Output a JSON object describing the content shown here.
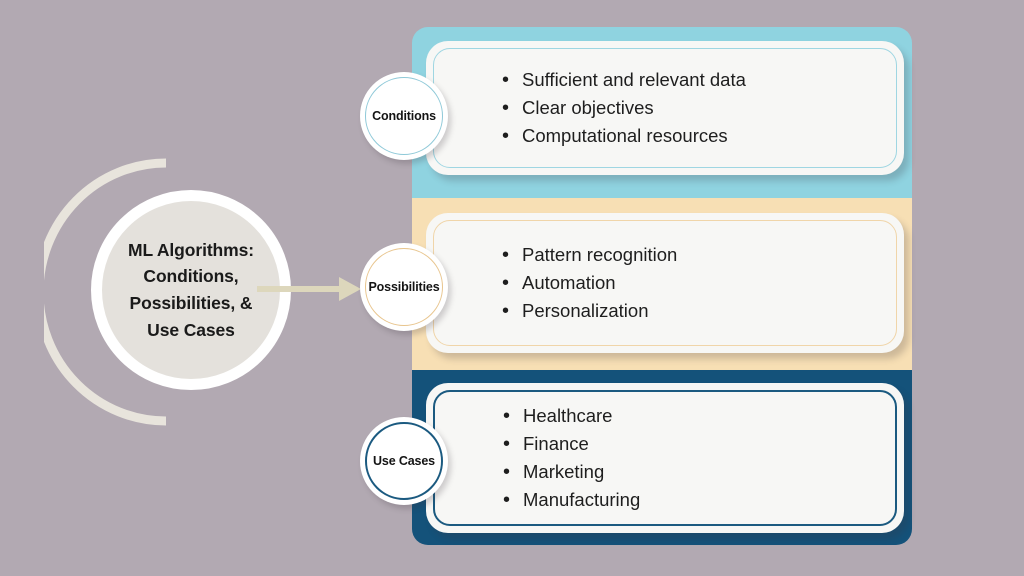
{
  "background_color": "#b2a9b2",
  "hub": {
    "title": "ML Algorithms: Conditions, Possibilities, & Use Cases",
    "title_lines": [
      "ML Algorithms:",
      "Conditions,",
      "Possibilities, &",
      "Use Cases"
    ],
    "fill_color": "#e4e1dc",
    "ring_color": "#ffffff",
    "arc_color": "#e8e4dc",
    "text_color": "#1a1a1a"
  },
  "arrow": {
    "name": "flow-arrow",
    "color": "#ddd7bc",
    "direction": "right"
  },
  "sections": [
    {
      "id": "conditions",
      "label": "Conditions",
      "band_color": "#8fd3e0",
      "border_color": "#9fd6e2",
      "card_color": "#f7f7f5",
      "items": [
        "Sufficient and relevant data",
        "Clear objectives",
        "Computational resources"
      ]
    },
    {
      "id": "possibilities",
      "label": "Possibilities",
      "band_color": "#f7dfb4",
      "border_color": "#f0d5a9",
      "card_color": "#f7f7f5",
      "items": [
        "Pattern recognition",
        "Automation",
        "Personalization"
      ]
    },
    {
      "id": "usecases",
      "label": "Use Cases",
      "band_color": "#14527a",
      "border_color": "#1b5a80",
      "card_color": "#f7f7f5",
      "items": [
        "Healthcare",
        "Finance",
        "Marketing",
        "Manufacturing"
      ]
    }
  ]
}
